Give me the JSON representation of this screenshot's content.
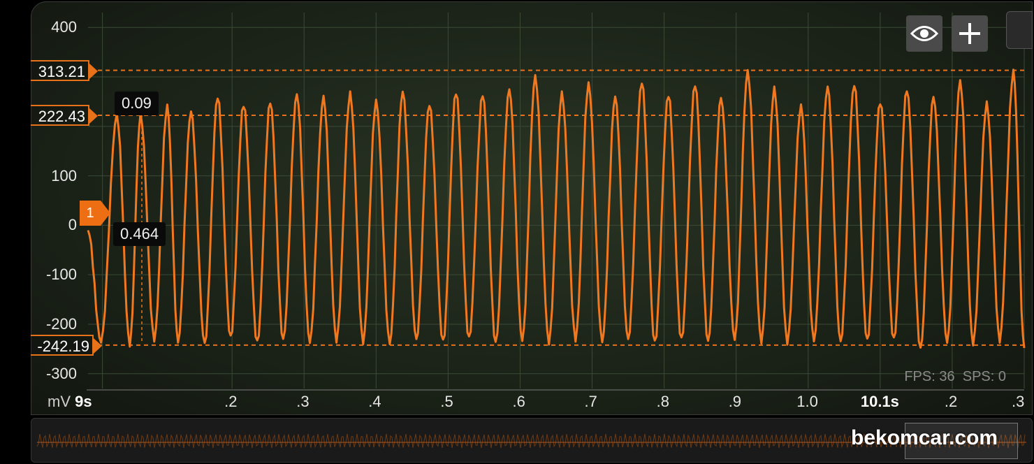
{
  "y_axis": {
    "unit": "mV",
    "ticks": [
      "400",
      "100",
      "0",
      "-100",
      "-200",
      "-300"
    ],
    "tick_values": [
      400,
      100,
      0,
      -100,
      -200,
      -300
    ],
    "range": [
      -330,
      430
    ]
  },
  "x_axis": {
    "start_label": "9s",
    "ticks": [
      ".2",
      ".3",
      ".4",
      ".5",
      ".6",
      ".7",
      ".8",
      ".9",
      "1.0",
      "10.1s",
      ".2",
      ".3"
    ],
    "tick_values": [
      9.2,
      9.3,
      9.4,
      9.5,
      9.6,
      9.7,
      9.8,
      9.9,
      10.0,
      10.1,
      10.2,
      10.3
    ],
    "bold_ticks": [
      "10.1s"
    ],
    "range": [
      9.0,
      10.3
    ]
  },
  "markers": [
    {
      "label": "313.21",
      "value": 313.21
    },
    {
      "label": "222.43",
      "value": 222.43
    },
    {
      "label": "-242.19",
      "value": -242.19
    }
  ],
  "channel_marker": {
    "label": "1",
    "value": 0
  },
  "cursor": {
    "time_label": "0.09",
    "value_label": "0.464"
  },
  "toolbar": {
    "eye_icon": "eye-icon",
    "add_icon": "plus-icon"
  },
  "stats": {
    "fps": "FPS: 36",
    "sps": "SPS: 0"
  },
  "watermark": "bekomcar.com",
  "colors": {
    "trace": "#f07820",
    "grid": "#3b4a36",
    "accent": "#e8721a"
  },
  "chart_data": {
    "type": "line",
    "title": "",
    "xlabel": "",
    "ylabel": "mV",
    "xlim": [
      9.0,
      10.3
    ],
    "ylim": [
      -330,
      430
    ],
    "grid": true,
    "series": [
      {
        "name": "1",
        "x": [
          9.0,
          9.018,
          9.04,
          9.058,
          9.073,
          9.092,
          9.11,
          9.125,
          9.143,
          9.162,
          9.18,
          9.198,
          9.216,
          9.235,
          9.253,
          9.271,
          9.29,
          9.308,
          9.327,
          9.345,
          9.364,
          9.382,
          9.4,
          9.419,
          9.437,
          9.456,
          9.474,
          9.493,
          9.511,
          9.529,
          9.548,
          9.566,
          9.585,
          9.603,
          9.621,
          9.64,
          9.658,
          9.677,
          9.695,
          9.714,
          9.732,
          9.75,
          9.769,
          9.787,
          9.806,
          9.824,
          9.843,
          9.861,
          9.879,
          9.898,
          9.916,
          9.935,
          9.953,
          9.971,
          9.99,
          10.008,
          10.027,
          10.045,
          10.064,
          10.082,
          10.1,
          10.119,
          10.137,
          10.156,
          10.174,
          10.193,
          10.211,
          10.229,
          10.248,
          10.266,
          10.285,
          10.3
        ],
        "y": [
          -10,
          -235,
          222,
          -240,
          222,
          -230,
          240,
          -235,
          230,
          -240,
          260,
          -228,
          245,
          -238,
          250,
          -232,
          265,
          -236,
          258,
          -232,
          265,
          -235,
          250,
          -238,
          270,
          -232,
          245,
          -236,
          270,
          -230,
          265,
          -238,
          275,
          -232,
          300,
          -236,
          265,
          -230,
          285,
          -234,
          260,
          -232,
          290,
          -238,
          265,
          -232,
          285,
          -236,
          258,
          -230,
          310,
          -234,
          275,
          -236,
          240,
          -232,
          280,
          -236,
          285,
          -234,
          250,
          -232,
          275,
          -250,
          260,
          -236,
          290,
          -238,
          245,
          -232,
          310,
          -248
        ]
      }
    ]
  }
}
